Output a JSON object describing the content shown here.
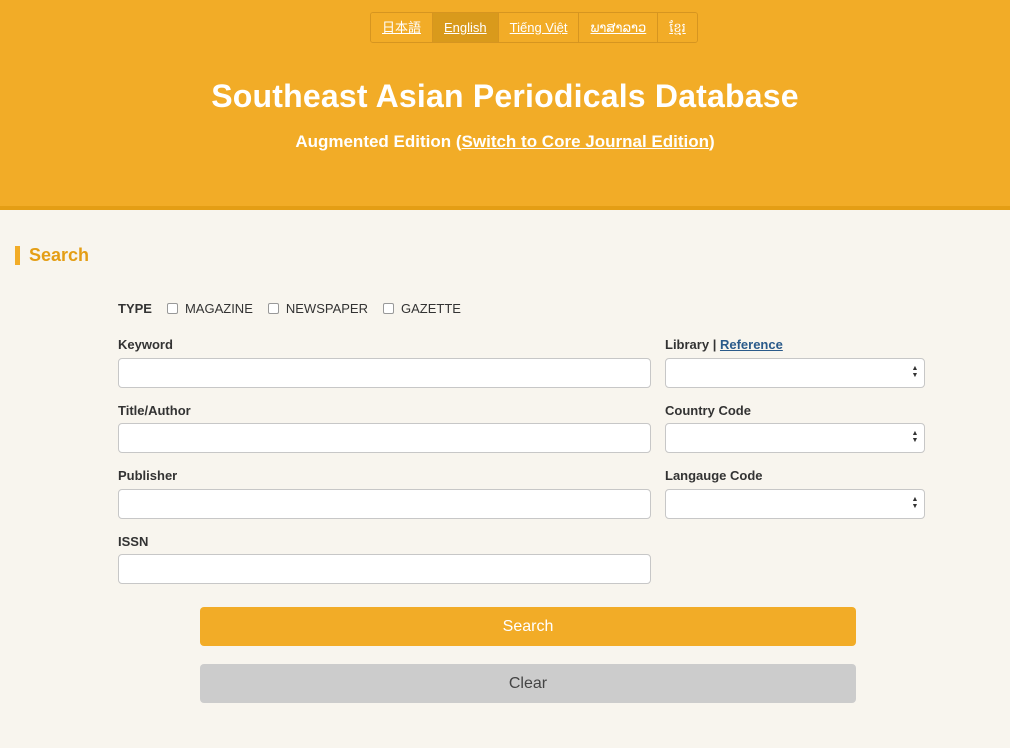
{
  "languages": [
    {
      "label": "日本語",
      "active": false
    },
    {
      "label": "English",
      "active": true
    },
    {
      "label": "Tiếng Việt",
      "active": false
    },
    {
      "label": "ພາສາລາວ",
      "active": false
    },
    {
      "label": "ខ្មែរ",
      "active": false
    }
  ],
  "header": {
    "title": "Southeast Asian Periodicals Database",
    "subtitle_prefix": "Augmented Edition (",
    "subtitle_link": "Switch to Core Journal Edition",
    "subtitle_suffix": ")"
  },
  "search": {
    "section_title": "Search",
    "type_label": "TYPE",
    "types": [
      "MAGAZINE",
      "NEWSPAPER",
      "GAZETTE"
    ],
    "keyword_label": "Keyword",
    "keyword_value": "",
    "title_author_label": "Title/Author",
    "title_author_value": "",
    "publisher_label": "Publisher",
    "publisher_value": "",
    "issn_label": "ISSN",
    "issn_value": "",
    "library_label": "Library",
    "library_separator": " | ",
    "reference_link": "Reference",
    "library_value": "",
    "country_code_label": "Country Code",
    "country_code_value": "",
    "language_code_label": "Langauge Code",
    "language_code_value": "",
    "search_button": "Search",
    "clear_button": "Clear"
  },
  "colors": {
    "accent": "#f2ac27",
    "accent_dark": "#e49e15",
    "background": "#f8f5ee",
    "clear_button": "#cccccc"
  }
}
